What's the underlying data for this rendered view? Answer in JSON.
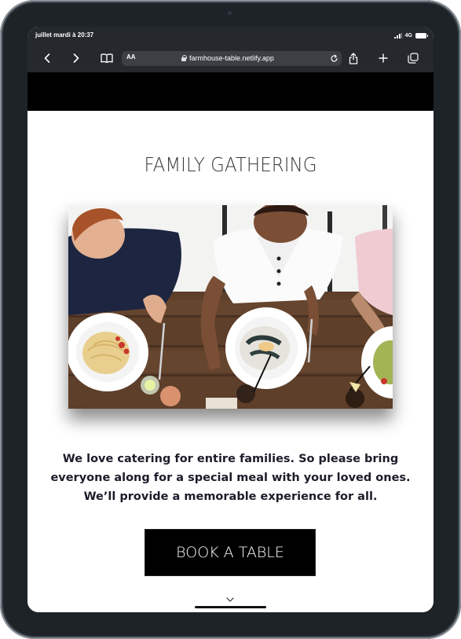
{
  "status_bar": {
    "time": "juillet mardi à 20:37",
    "network": "4G",
    "signal_icon": "cellular-signal-icon",
    "battery_icon": "battery-icon"
  },
  "browser": {
    "aa_label": "AA",
    "url": "farmhouse-table.netlify.app",
    "icons": [
      "back-chevron-icon",
      "forward-chevron-icon",
      "bookmarks-book-icon",
      "lock-icon",
      "reload-icon",
      "share-icon",
      "plus-icon",
      "tabs-icon"
    ]
  },
  "page": {
    "title": "FAMILY GATHERING",
    "description": "We love catering for entire families. So please bring everyone along for a special meal with your loved ones. We’ll provide a memorable experience for all.",
    "book_button": "BOOK A TABLE",
    "colors": {
      "header_bar": "#000000",
      "button_bg": "#000000",
      "button_text": "#ffffff",
      "text": "#1c1c2a",
      "browser_chrome": "#25282c"
    }
  }
}
